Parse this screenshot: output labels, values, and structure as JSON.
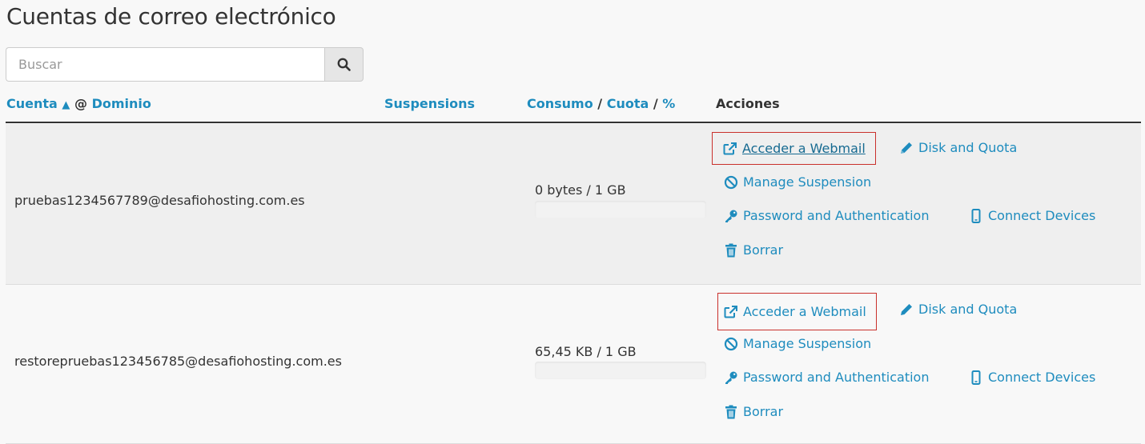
{
  "page": {
    "title": "Cuentas de correo electrónico"
  },
  "search": {
    "placeholder": "Buscar"
  },
  "table": {
    "headers": {
      "account": "Cuenta",
      "sort_arrow": "▲",
      "at": "@",
      "domain": "Dominio",
      "suspensions": "Suspensions",
      "usage": "Consumo",
      "slash1": "/",
      "quota": "Cuota",
      "slash2": "/",
      "percent": "%",
      "actions": "Acciones"
    },
    "rows": [
      {
        "account": "pruebas1234567789@desafiohosting.com.es",
        "usage": "0 bytes / 1 GB",
        "usage_fraction": 0,
        "actions": {
          "webmail": "Acceder a Webmail",
          "disk": "Disk and Quota",
          "manage": "Manage Suspension",
          "password": "Password and Authentication",
          "devices": "Connect Devices",
          "delete": "Borrar"
        }
      },
      {
        "account": "restorepruebas123456785@desafiohosting.com.es",
        "usage": "65,45 KB / 1 GB",
        "usage_fraction": 0.0001,
        "actions": {
          "webmail": "Acceder a Webmail",
          "disk": "Disk and Quota",
          "manage": "Manage Suspension",
          "password": "Password and Authentication",
          "devices": "Connect Devices",
          "delete": "Borrar"
        }
      }
    ]
  },
  "colors": {
    "link": "#1e8cbe",
    "highlight_border": "#c9302c",
    "text": "#333333"
  },
  "icons": [
    "search-icon",
    "external-link-icon",
    "pencil-icon",
    "ban-icon",
    "key-icon",
    "mobile-icon",
    "trash-icon"
  ]
}
